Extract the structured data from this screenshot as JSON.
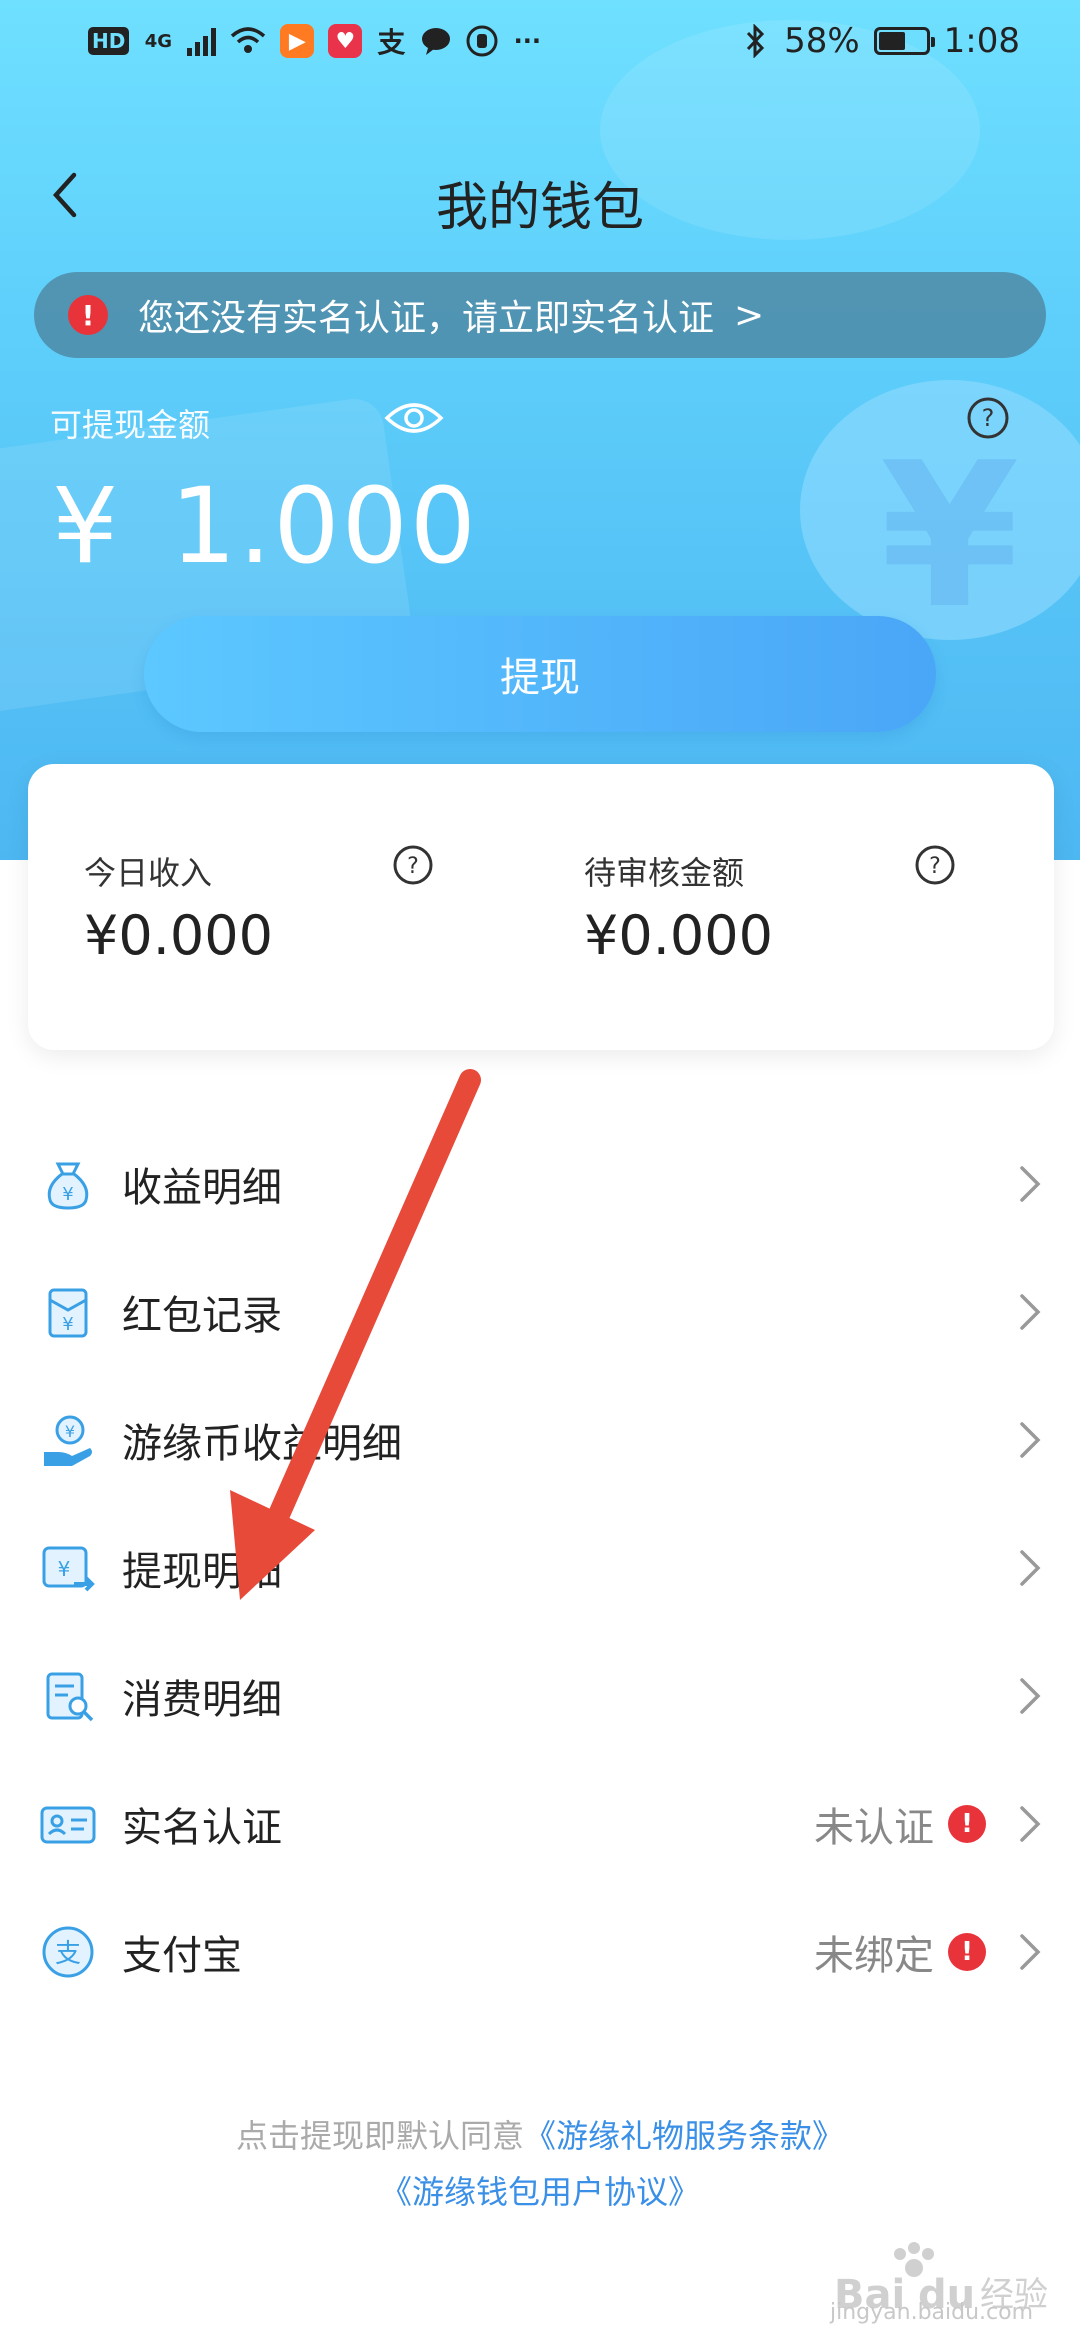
{
  "status_bar": {
    "hd": "HD",
    "network": "4G",
    "battery": "58%",
    "time": "1:08",
    "more": "···"
  },
  "header": {
    "title": "我的钱包"
  },
  "banner": {
    "text": "您还没有实名认证，请立即实名认证",
    "arrow": ">"
  },
  "balance": {
    "label": "可提现金额",
    "currency": "¥",
    "amount": "1.000"
  },
  "withdraw_button": "提现",
  "summary": {
    "today_income_label": "今日收入",
    "today_income_value": "¥0.000",
    "pending_label": "待审核金额",
    "pending_value": "¥0.000"
  },
  "menu": {
    "items": [
      {
        "label": "收益明细",
        "icon": "money-bag-icon"
      },
      {
        "label": "红包记录",
        "icon": "red-packet-icon"
      },
      {
        "label": "游缘币收益明细",
        "icon": "coin-hand-icon"
      },
      {
        "label": "提现明细",
        "icon": "withdraw-record-icon"
      },
      {
        "label": "消费明细",
        "icon": "consume-search-icon"
      },
      {
        "label": "实名认证",
        "icon": "id-card-icon",
        "status": "未认证"
      },
      {
        "label": "支付宝",
        "icon": "alipay-icon",
        "status": "未绑定"
      }
    ]
  },
  "footer": {
    "line1_prefix": "点击提现即默认同意",
    "line1_link": "《游缘礼物服务条款》",
    "line2_link": "《游缘钱包用户协议》"
  },
  "watermark": {
    "text": "jingyan.baidu.com"
  },
  "colors": {
    "accent": "#3a8fe6",
    "warning": "#e8333a",
    "annotation_arrow": "#e84a3a"
  }
}
